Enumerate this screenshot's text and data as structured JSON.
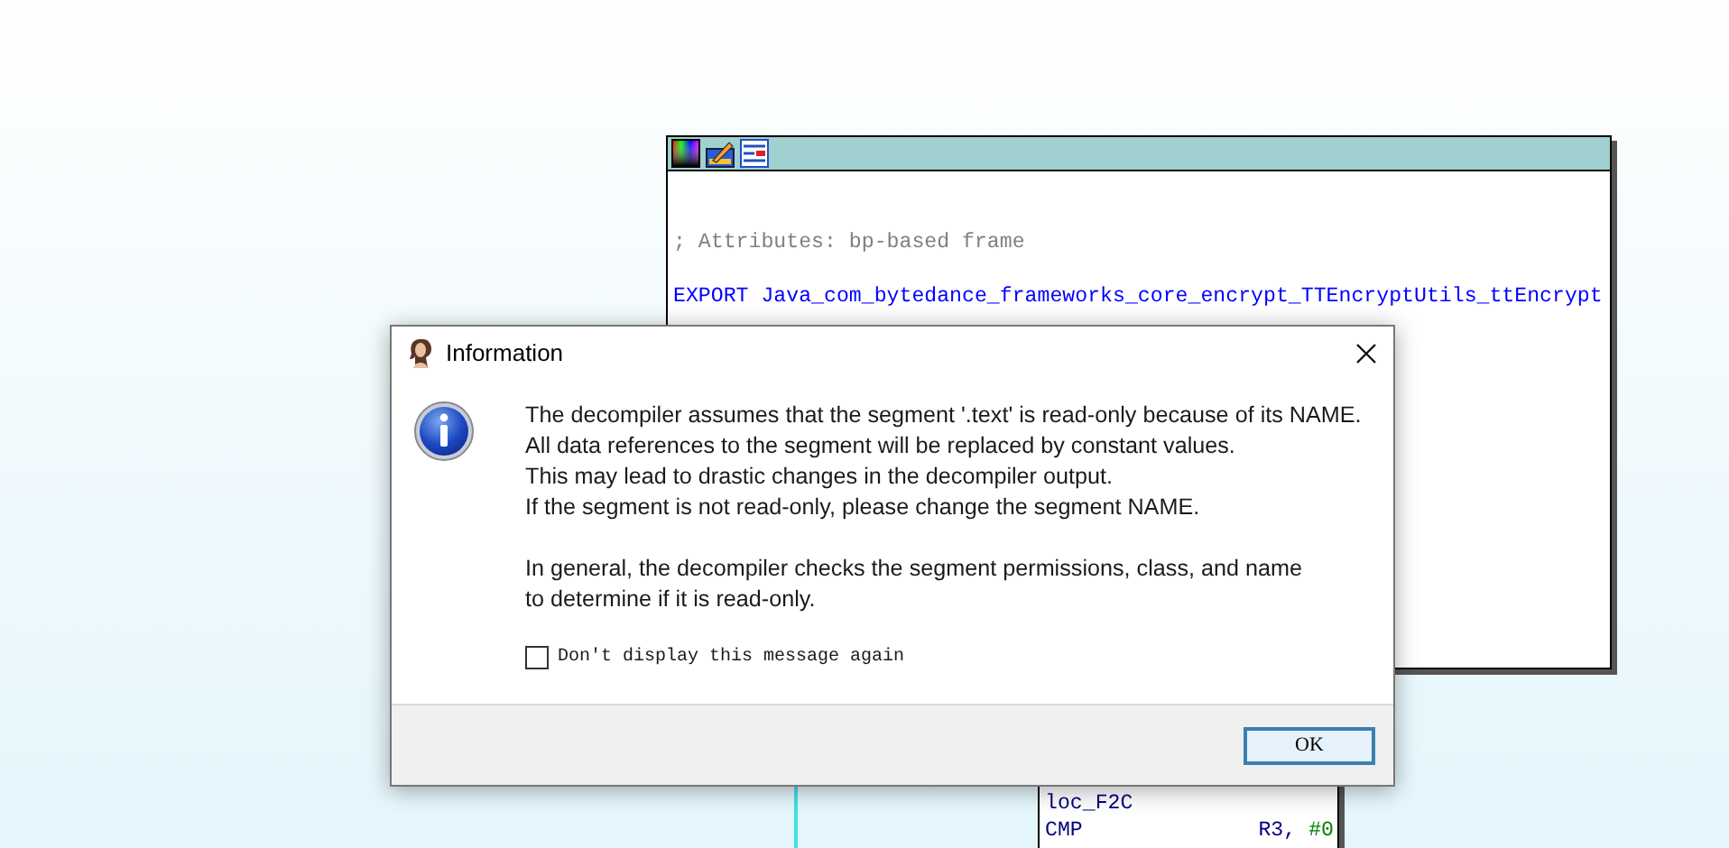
{
  "graph_nodes": [
    {
      "kind": "function",
      "lines": [
        {
          "kind": "comment",
          "text": "; Attributes: bp-based frame"
        },
        {
          "kind": "export",
          "text": "EXPORT Java_com_bytedance_frameworks_core_encrypt_TTEncryptUtils_ttEncrypt"
        }
      ]
    },
    {
      "kind": "block",
      "lines": [
        {
          "kind": "label",
          "text": "loc_F2C"
        },
        {
          "kind": "instruction",
          "mnemonic": "CMP",
          "operands": [
            {
              "kind": "register",
              "text": "R3,"
            },
            {
              "kind": "immediate",
              "text": "#0"
            }
          ]
        }
      ]
    }
  ],
  "dialog": {
    "title": "Information",
    "paragraphs": [
      [
        "The decompiler assumes that the segment '.text' is read-only because of its NAME.",
        "All data references to the segment will be replaced by constant values.",
        "This may lead to drastic changes in the decompiler output.",
        "If the segment is not read-only, please change the segment NAME."
      ],
      [
        "In general, the decompiler checks the segment permissions, class, and name",
        "to determine if it is read-only."
      ]
    ],
    "checkbox": {
      "label": "Don't display this message again",
      "checked": false
    },
    "buttons": [
      {
        "label": "OK",
        "default": true
      }
    ]
  }
}
